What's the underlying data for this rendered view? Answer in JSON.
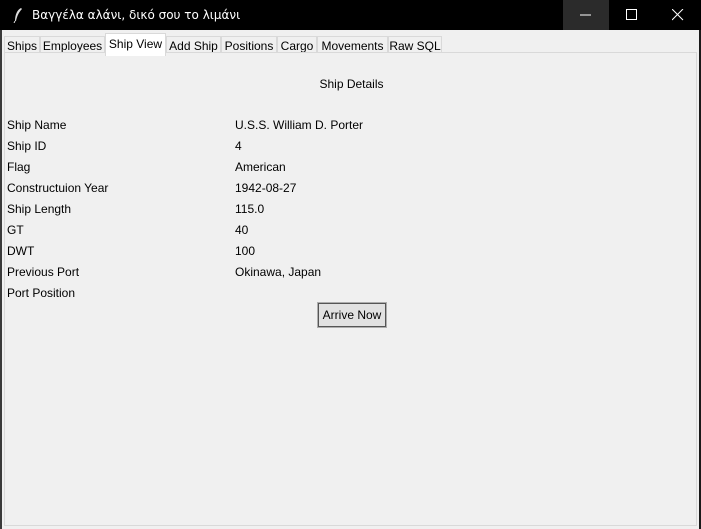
{
  "window": {
    "title": "Βαγγέλα αλάνι, δικό σου το λιμάνι",
    "icon": "feather-icon",
    "controls": [
      "minimize-icon",
      "maximize-icon",
      "close-icon"
    ]
  },
  "tabs": [
    {
      "label": "Ships",
      "active": false
    },
    {
      "label": "Employees",
      "active": false
    },
    {
      "label": "Ship View",
      "active": true
    },
    {
      "label": "Add Ship",
      "active": false
    },
    {
      "label": "Positions",
      "active": false
    },
    {
      "label": "Cargo",
      "active": false
    },
    {
      "label": "Movements",
      "active": false
    },
    {
      "label": "Raw SQL",
      "active": false
    }
  ],
  "details": {
    "title": "Ship Details",
    "rows": [
      {
        "label": "Ship Name",
        "value": "U.S.S. William D. Porter"
      },
      {
        "label": "Ship ID",
        "value": "4"
      },
      {
        "label": "Flag",
        "value": "American"
      },
      {
        "label": "Constructuion Year",
        "value": "1942-08-27"
      },
      {
        "label": "Ship Length",
        "value": "115.0"
      },
      {
        "label": "GT",
        "value": "40"
      },
      {
        "label": "DWT",
        "value": "100"
      },
      {
        "label": "Previous Port",
        "value": "Okinawa, Japan"
      },
      {
        "label": "Port Position",
        "value": ""
      }
    ],
    "arrive_button": "Arrive Now"
  }
}
